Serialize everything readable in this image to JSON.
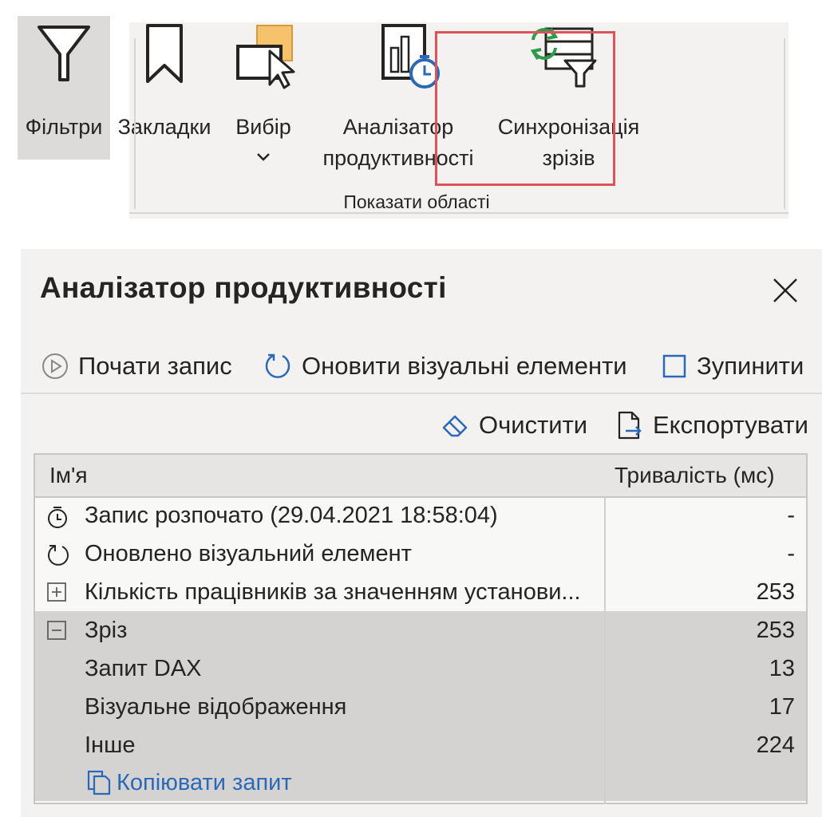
{
  "ribbon": {
    "buttons": {
      "filters": "Фільтри",
      "bookmarks": "Закладки",
      "selection": "Вибір",
      "perf_line1": "Аналізатор",
      "perf_line2": "продуктивності",
      "sync_line1": "Синхронізація",
      "sync_line2": "зрізів"
    },
    "group_label": "Показати області",
    "highlight_color": "#e0525a"
  },
  "pane": {
    "title": "Аналізатор продуктивності",
    "toolbar": {
      "start": "Почати запис",
      "refresh": "Оновити візуальні елементи",
      "stop": "Зупинити",
      "clear": "Очистити",
      "export": "Експортувати"
    },
    "table": {
      "col_name": "Ім'я",
      "col_duration": "Тривалість (мс)",
      "rows": [
        {
          "icon": "stopwatch-icon",
          "name": "Запис розпочато (29.04.2021 18:58:04)",
          "duration": "-"
        },
        {
          "icon": "refresh-icon",
          "name": "Оновлено візуальний елемент",
          "duration": "-"
        },
        {
          "icon": "expand-plus-icon",
          "name": "Кількість працівників за значенням установи...",
          "duration": "253"
        },
        {
          "icon": "collapse-minus-icon",
          "name": "Зріз",
          "duration": "253"
        },
        {
          "name": "Запит DAX",
          "duration": "13"
        },
        {
          "name": "Візуальне відображення",
          "duration": "17"
        },
        {
          "name": "Інше",
          "duration": "224"
        }
      ],
      "copy_query": "Копіювати запит"
    },
    "link_color": "#2c68b8"
  }
}
